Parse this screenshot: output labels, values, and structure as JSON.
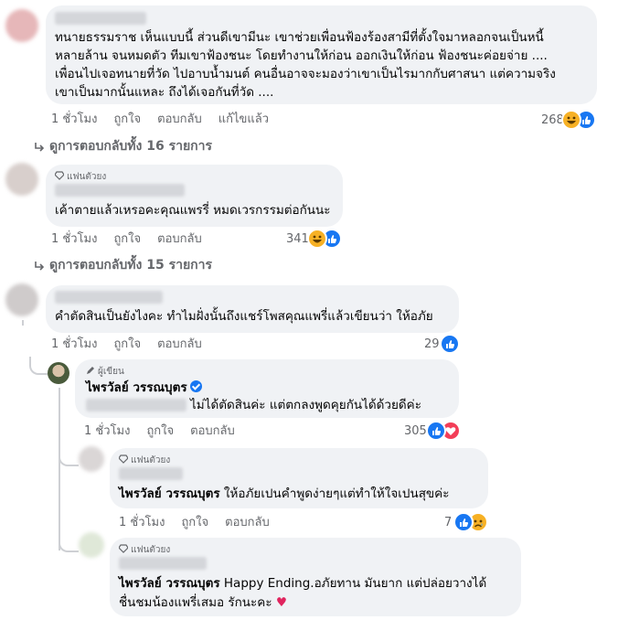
{
  "colors": {
    "like": "#1877f2",
    "haha": "#f7b125",
    "love": "#f33e58",
    "text_secondary": "#65676b",
    "bubble": "#f0f2f5"
  },
  "comment1": {
    "lines": [
      "ทนายธรรมราช เห็นแบบนี้ ส่วนดีเขามีนะ เขาช่วยเพื่อนฟ้องร้องสามีที่ตั้งใจมาหลอกจนเป็นหนี้",
      "หลายล้าน จนหมดตัว ทีมเขาฟ้องชนะ โดยทำงานให้ก่อน ออกเงินให้ก่อน ฟ้องชนะค่อยจ่าย ....",
      "เพื่อนไปเจอทนายที่วัด ไปอาบน้ำมนต์ คนอื่นอาจจะมองว่าเขาเป็นไรมากกับศาสนา แต่ความจริง",
      "เขาเป็นมากนั้นแหละ ถึงได้เจอกันที่วัด ...."
    ],
    "time": "1 ชั่วโมง",
    "like": "ถูกใจ",
    "reply": "ตอบกลับ",
    "edited": "แก้ไขแล้ว",
    "count": "268",
    "reactions": [
      "haha",
      "like"
    ]
  },
  "more1": "ดูการตอบกลับทั้ง 16 รายการ",
  "comment2": {
    "badge": "แฟนตัวยง",
    "text": "เค้าตายแล้วเหรอคะคุณแพรรี่ หมดเวรกรรมต่อกันนะ",
    "time": "1 ชั่วโมง",
    "like": "ถูกใจ",
    "reply": "ตอบกลับ",
    "count": "341",
    "reactions": [
      "haha",
      "like"
    ]
  },
  "more2": "ดูการตอบกลับทั้ง 15 รายการ",
  "comment3": {
    "text": "คำตัดสินเป็นยังไงคะ ทำไมฝั่งนั้นถึงแชร์โพสคุณแพรี่แล้วเขียนว่า ให้อภัย",
    "time": "1 ชั่วโมง",
    "like": "ถูกใจ",
    "reply": "ตอบกลับ",
    "count": "29",
    "reactions": [
      "like"
    ]
  },
  "reply1": {
    "badge": "ผู้เขียน",
    "author": "ไพรวัลย์ วรรณบุตร",
    "text": "ไม่ได้ตัดสินค่ะ แต่ตกลงพูดคุยกันได้ด้วยดีค่ะ",
    "time": "1 ชั่วโมง",
    "like": "ถูกใจ",
    "reply": "ตอบกลับ",
    "count": "305",
    "reactions": [
      "like",
      "love"
    ]
  },
  "reply2": {
    "badge": "แฟนตัวยง",
    "mention": "ไพรวัลย์ วรรณบุตร",
    "text": "ให้อภัยเปนคำพูดง่ายๆแต่ทำให้ใจเปนสุขค่ะ",
    "time": "1 ชั่วโมง",
    "like": "ถูกใจ",
    "reply": "ตอบกลับ",
    "count": "7",
    "reactions": [
      "like",
      "sad"
    ]
  },
  "reply3": {
    "badge": "แฟนตัวยง",
    "mention": "ไพรวัลย์ วรรณบุตร",
    "line1": "Happy Ending.อภัยทาน มันยาก แต่ปล่อยวางได้",
    "line2": "ชื่นชมน้องแพรี่เสมอ รักนะคะ",
    "heart": "♥"
  }
}
